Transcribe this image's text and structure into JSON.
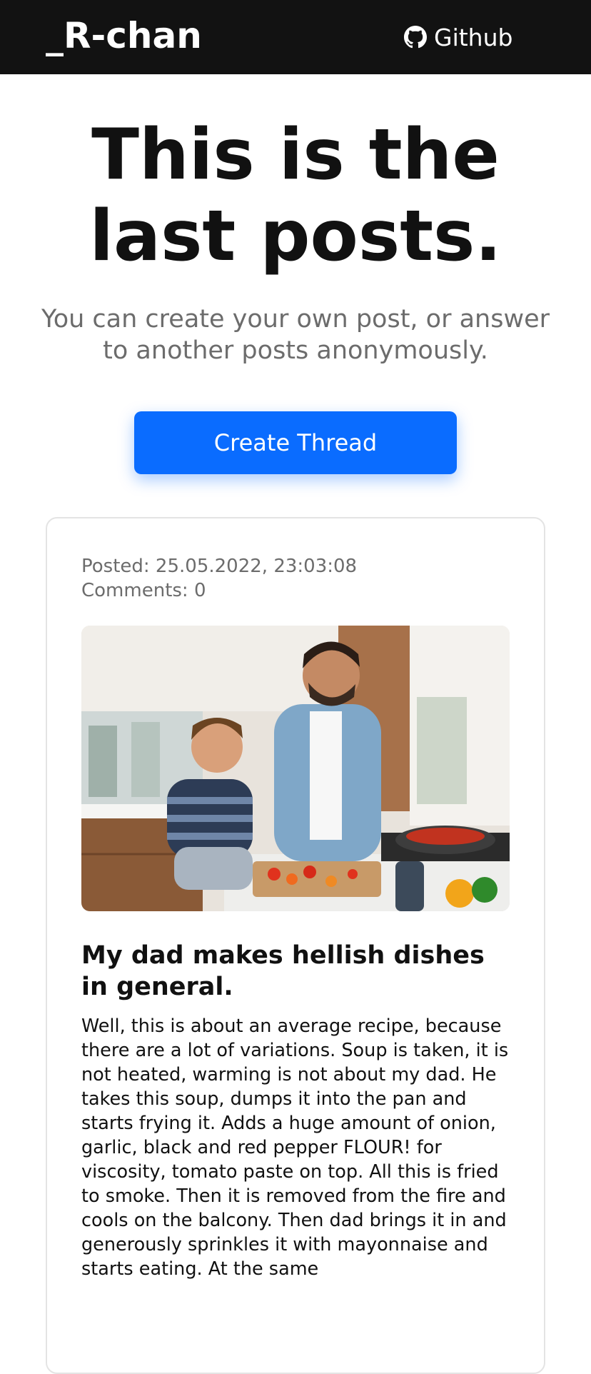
{
  "navbar": {
    "brand": "_R-chan",
    "github_label": "Github",
    "github_icon": "github-icon",
    "background": "#121212"
  },
  "hero": {
    "title": "This is the last posts.",
    "subtitle": "You can create your own post, or answer to another posts anonymously.",
    "create_button_label": "Create Thread",
    "accent": "#0a6cff"
  },
  "posts": [
    {
      "posted": "Posted: 25.05.2022, 23:03:08",
      "comments": "Comments: 0",
      "image_subject": "father and son cooking vegetables in kitchen",
      "title": "My dad makes hellish dishes in general.",
      "body": "Well, this is about an average recipe, because there are a lot of variations. Soup is taken, it is not heated, warming is not about my dad. He takes this soup, dumps it into the pan and starts frying it. Adds a huge amount of onion, garlic, black and red pepper FLOUR! for viscosity, tomato paste on top. All this is fried to smoke. Then it is removed from the fire and cools on the balcony. Then dad brings it in and generously sprinkles it with mayonnaise and starts eating. At the same"
    }
  ]
}
